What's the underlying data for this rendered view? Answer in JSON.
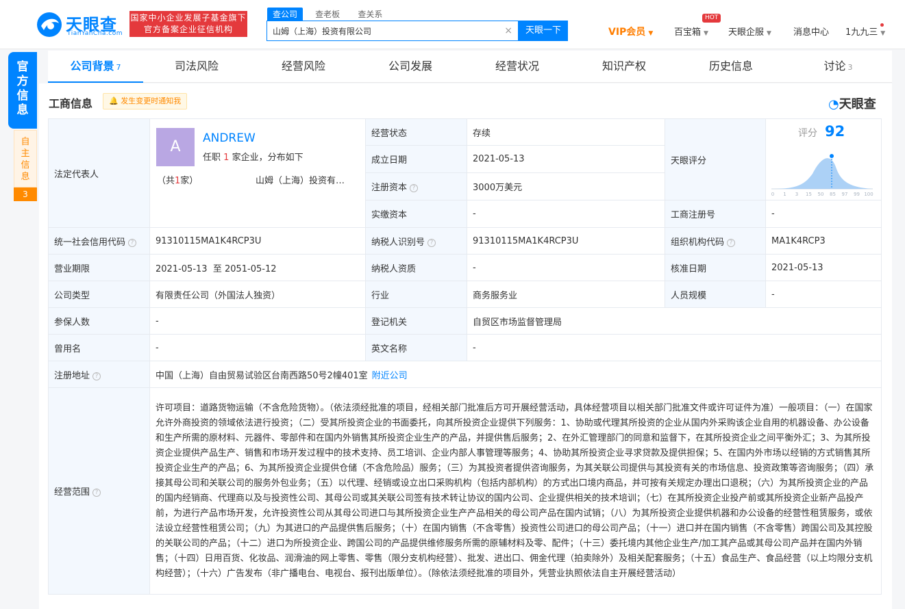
{
  "header": {
    "logo_name": "天眼查",
    "logo_sub": "TianYanCha.com",
    "slogan_line1": "国家中小企业发展子基金旗下",
    "slogan_line2": "官方备案企业征信机构",
    "search_tabs": [
      "查公司",
      "查老板",
      "查关系"
    ],
    "search_value": "山姆（上海）投资有限公司",
    "search_button": "天眼一下",
    "vip": "VIP会员",
    "baibaoxiang": "百宝箱",
    "hot": "HOT",
    "enterprise_service": "天眼企服",
    "messages": "消息中心",
    "user": "1九九三"
  },
  "side": {
    "official": "官方信息",
    "self": "自主信息",
    "self_count": "3"
  },
  "tabs": [
    {
      "label": "公司背景",
      "count": "7"
    },
    {
      "label": "司法风险",
      "count": ""
    },
    {
      "label": "经营风险",
      "count": ""
    },
    {
      "label": "公司发展",
      "count": ""
    },
    {
      "label": "经营状况",
      "count": ""
    },
    {
      "label": "知识产权",
      "count": ""
    },
    {
      "label": "历史信息",
      "count": ""
    },
    {
      "label": "讨论",
      "count": "3"
    }
  ],
  "section": {
    "title": "工商信息",
    "notice": "发生变更时通知我",
    "brand": "天眼查"
  },
  "legal_rep": {
    "label": "法定代表人",
    "avatar": "A",
    "name": "ANDREW",
    "desc_pre": "任职",
    "desc_num": "1",
    "desc_post": "家企业，分布如下",
    "count_pre": "（共",
    "count_num": "1",
    "count_post": "家）",
    "company": "山姆（上海）投资有…"
  },
  "score": {
    "label": "天眼评分",
    "score_label": "评分",
    "value": "92",
    "axis": [
      "0",
      "1",
      "3",
      "15",
      "50",
      "85",
      "97",
      "99",
      "100"
    ]
  },
  "rows": {
    "status_label": "经营状态",
    "status": "存续",
    "founded_label": "成立日期",
    "founded": "2021-05-13",
    "capital_label": "注册资本",
    "capital": "3000万美元",
    "paid_label": "实缴资本",
    "paid": "-",
    "reg_no_label": "工商注册号",
    "reg_no": "-",
    "credit_label": "统一社会信用代码",
    "credit": "91310115MA1K4RCP3U",
    "taxid_label": "纳税人识别号",
    "taxid": "91310115MA1K4RCP3U",
    "org_label": "组织机构代码",
    "org": "MA1K4RCP3",
    "term_label": "营业期限",
    "term": "2021-05-13  至 2051-05-12",
    "taxq_label": "纳税人资质",
    "taxq": "-",
    "approve_label": "核准日期",
    "approve": "2021-05-13",
    "type_label": "公司类型",
    "type": "有限责任公司（外国法人独资）",
    "industry_label": "行业",
    "industry": "商务服务业",
    "staff_label": "人员规模",
    "staff": "-",
    "insured_label": "参保人数",
    "insured": "-",
    "authority_label": "登记机关",
    "authority": "自贸区市场监督管理局",
    "former_label": "曾用名",
    "former": "-",
    "english_label": "英文名称",
    "english": "-",
    "address_label": "注册地址",
    "address": "中国（上海）自由贸易试验区台南西路50号2幢401室",
    "nearby": "附近公司",
    "scope_label": "经营范围",
    "scope": "许可项目：道路货物运输（不含危险货物）。（依法须经批准的项目，经相关部门批准后方可开展经营活动，具体经营项目以相关部门批准文件或许可证件为准）一般项目：（一）在国家允许外商投资的领域依法进行投资；（二）受其所投资企业的书面委托，向其所投资企业提供下列服务：1、协助或代理其所投资的企业从国内外采购该企业自用的机器设备、办公设备和生产所需的原材料、元器件、零部件和在国内外销售其所投资企业生产的产品，并提供售后服务；2、在外汇管理部门的同意和监督下，在其所投资企业之间平衡外汇；3、为其所投资企业提供产品生产、销售和市场开发过程中的技术支持、员工培训、企业内部人事管理等服务；4、协助其所投资企业寻求贷款及提供担保；5、在国内外市场以经销的方式销售其所投资企业生产的产品；6、为其所投资企业提供仓储（不含危险品）服务；（三）为其投资者提供咨询服务，为其关联公司提供与其投资有关的市场信息、投资政策等咨询服务；（四）承接其母公司和关联公司的服务外包业务；（五）以代理、经销或设立出口采购机构（包括内部机构）的方式出口境内商品，并可按有关规定办理出口退税；（六）为其所投资企业的产品的国内经销商、代理商以及与投资性公司、其母公司或其关联公司签有技术转让协议的国内公司、企业提供相关的技术培训；（七）在其所投资企业投产前或其所投资企业新产品投产前，为进行产品市场开发，允许投资性公司从其母公司进口与其所投资企业生产产品相关的母公司产品在国内试销；（八）为其所投资企业提供机器和办公设备的经营性租赁服务，或依法设立经营性租赁公司；（九）为其进口的产品提供售后服务；（十）在国内销售（不含零售）投资性公司进口的母公司产品；（十一）进口并在国内销售（不含零售）跨国公司及其控股的关联公司的产品；（十二）进口为所投资企业、跨国公司的产品提供维修服务所需的原辅材料及零、配件；（十三）委托境内其他企业生产/加工其产品或其母公司产品并在国内外销售；（十四）日用百货、化妆品、润滑油的网上零售、零售（限分支机构经营）、批发、进出口、佣金代理（拍卖除外）及相关配套服务；（十五）食品生产、食品经营（以上均限分支机构经营）；（十六）广告发布（非广播电台、电视台、报刊出版单位）。（除依法须经批准的项目外，凭营业执照依法自主开展经营活动）"
  }
}
